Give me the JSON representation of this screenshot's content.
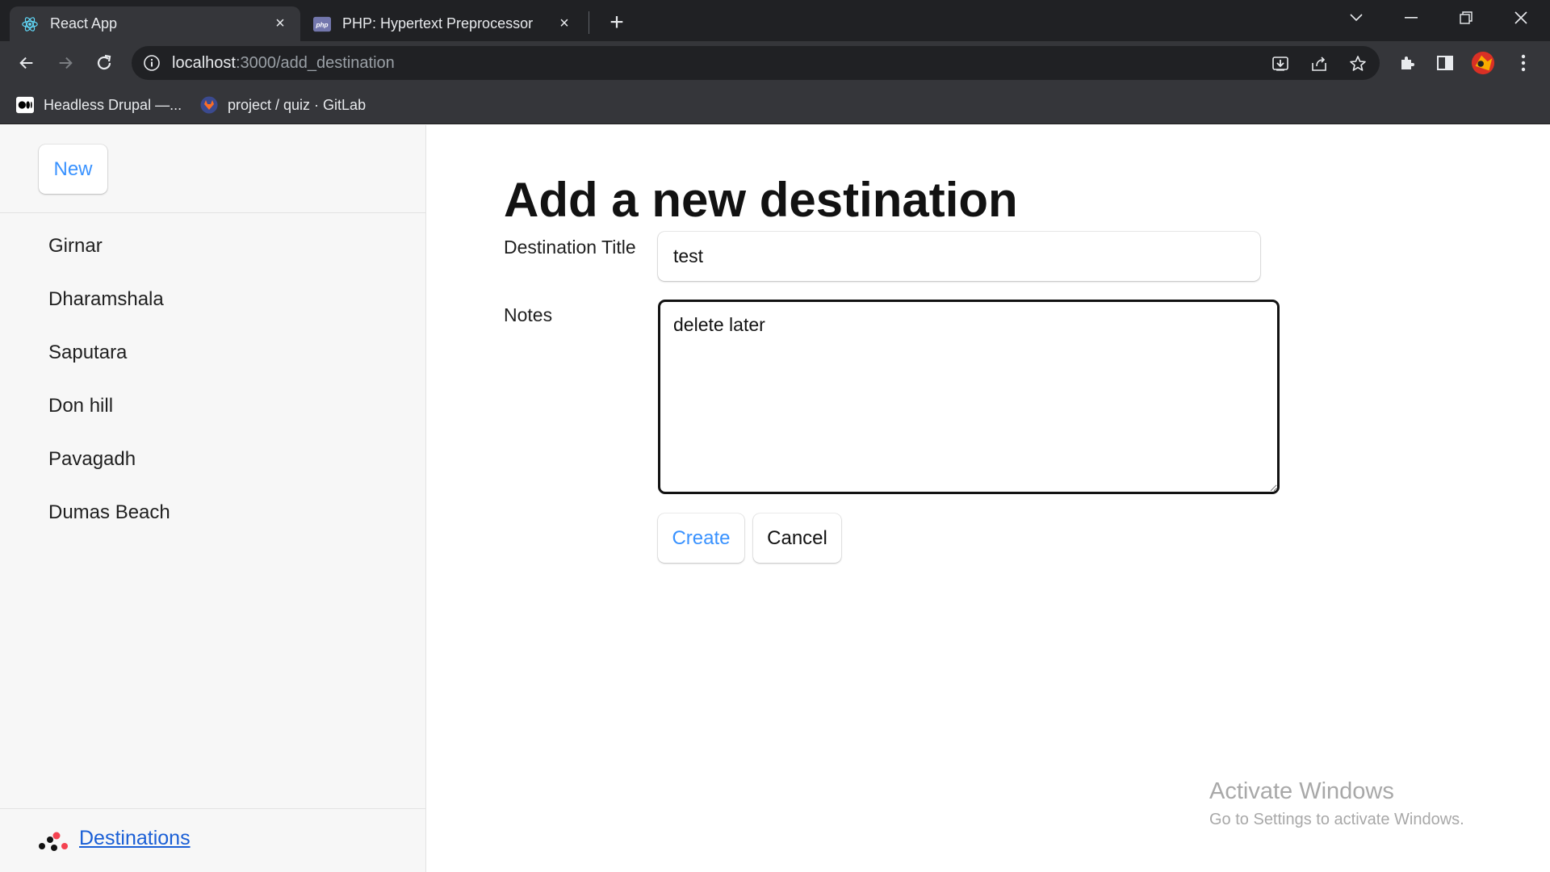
{
  "browser": {
    "tabs": [
      {
        "title": "React App",
        "favicon": "react-icon",
        "active": true
      },
      {
        "title": "PHP: Hypertext Preprocessor",
        "favicon": "php-icon",
        "active": false
      }
    ],
    "url_host": "localhost",
    "url_rest": ":3000/add_destination",
    "bookmarks": [
      {
        "title": "Headless Drupal —...",
        "icon": "medium-icon"
      },
      {
        "title": "project / quiz · GitLab",
        "icon": "gitlab-icon"
      }
    ]
  },
  "sidebar": {
    "new_label": "New",
    "items": [
      "Girnar",
      "Dharamshala",
      "Saputara",
      "Don hill",
      "Pavagadh",
      "Dumas Beach"
    ],
    "footer_link": "Destinations"
  },
  "form": {
    "title": "Add a new destination",
    "title_label": "Destination Title",
    "title_value": "test",
    "notes_label": "Notes",
    "notes_value": "delete later",
    "create_label": "Create",
    "cancel_label": "Cancel"
  },
  "watermark": {
    "title": "Activate Windows",
    "subtitle": "Go to Settings to activate Windows."
  },
  "colors": {
    "accent": "#3992ff",
    "link": "#1a5fd6",
    "chrome_dark": "#202124",
    "chrome_toolbar": "#35363a"
  }
}
